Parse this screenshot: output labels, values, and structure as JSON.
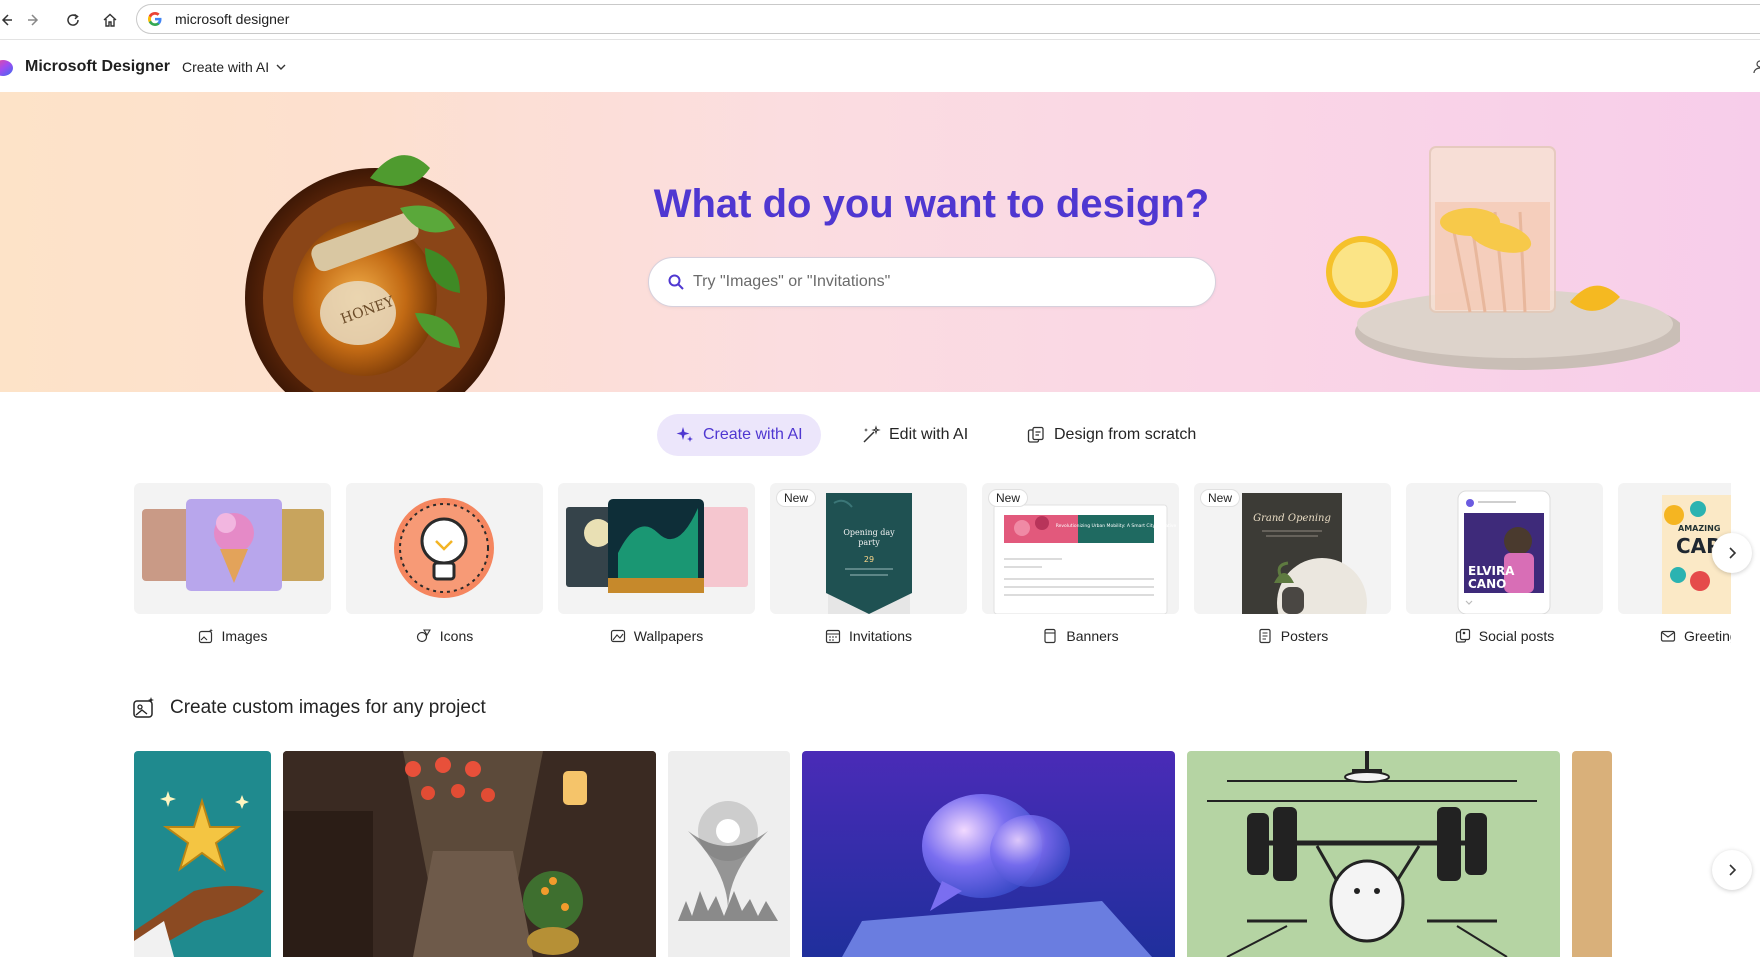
{
  "browser": {
    "address": "microsoft designer",
    "icons": [
      "back-icon",
      "forward-icon",
      "reload-icon",
      "home-icon",
      "google-icon"
    ]
  },
  "app": {
    "brand": "Microsoft Designer",
    "create_menu": "Create with AI"
  },
  "hero": {
    "title": "What do you want to design?",
    "search_placeholder": "Try \"Images\" or \"Invitations\"",
    "accent": "#4f37d1"
  },
  "modes": [
    {
      "label": "Create with AI",
      "icon": "sparkle-icon",
      "active": true
    },
    {
      "label": "Edit with AI",
      "icon": "magic-wand-icon",
      "active": false
    },
    {
      "label": "Design from scratch",
      "icon": "design-scratch-icon",
      "active": false
    }
  ],
  "categories": [
    {
      "label": "Images",
      "icon": "image-sparkle-icon",
      "badge": ""
    },
    {
      "label": "Icons",
      "icon": "icon-shapes-icon",
      "badge": ""
    },
    {
      "label": "Wallpapers",
      "icon": "wallpaper-icon",
      "badge": ""
    },
    {
      "label": "Invitations",
      "icon": "calendar-icon",
      "badge": "New"
    },
    {
      "label": "Banners",
      "icon": "banner-icon",
      "badge": "New"
    },
    {
      "label": "Posters",
      "icon": "poster-icon",
      "badge": "New"
    },
    {
      "label": "Social posts",
      "icon": "social-post-icon",
      "badge": ""
    },
    {
      "label": "Greeting",
      "icon": "envelope-icon",
      "badge": ""
    }
  ],
  "thumb_text": {
    "invitation": [
      "Opening day",
      "party"
    ],
    "invitation_date": "29",
    "banner": "Revolutionizing Urban Mobility: A Smart City Initiative",
    "poster": "Grand Opening",
    "social": [
      "ELVIRA",
      "CANO"
    ],
    "greeting": [
      "AMAZING",
      "CAR"
    ]
  },
  "section": {
    "title": "Create custom images for any project",
    "icon": "image-sparkle-icon"
  }
}
